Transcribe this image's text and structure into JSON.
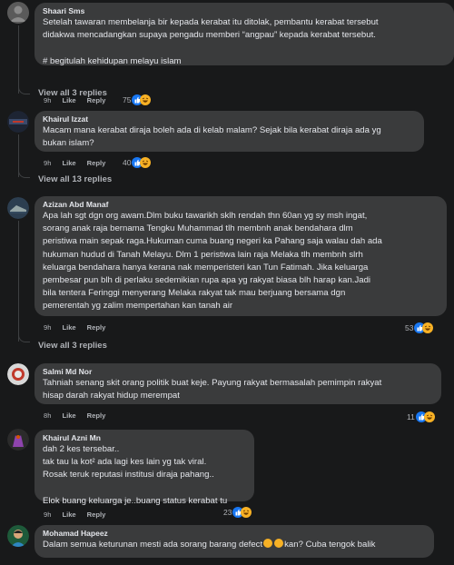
{
  "comments": [
    {
      "name": "Shaari Sms",
      "text": "Setelah tawaran membelanja bir kepada kerabat itu ditolak, pembantu kerabat tersebut\ndidakwa mencadangkan supaya pengadu memberi “angpau” kepada kerabat tersebut.\n\n# begitulah kehidupan melayu islam",
      "time": "9h",
      "like": "Like",
      "reply": "Reply",
      "reactions": "75",
      "view_replies": "View all 3 replies"
    },
    {
      "name": "Khairul Izzat",
      "text": "Macam mana kerabat diraja boleh ada di kelab malam? Sejak bila kerabat diraja ada yg\nbukan islam?",
      "time": "9h",
      "like": "Like",
      "reply": "Reply",
      "reactions": "40",
      "view_replies": "View all 13 replies"
    },
    {
      "name": "Azizan Abd Manaf",
      "text": "Apa lah sgt dgn org awam.Dlm buku tawarikh sklh rendah thn 60an yg sy msh ingat,\nsorang anak raja bernama Tengku Muhammad tlh membnh anak bendahara dlm\nperistiwa main sepak raga.Hukuman cuma buang negeri ka Pahang saja walau dah ada\nhukuman hudud di Tanah Melayu. Dlm 1 peristiwa lain raja Melaka tlh membnh slrh\nkeluarga bendahara hanya kerana nak memperisteri kan Tun Fatimah. Jika keluarga\npembesar pun blh di perlaku sedemikian rupa apa yg rakyat biasa blh harap kan.Jadi\nbila tentera Feringgi menyerang Melaka rakyat tak mau berjuang bersama dgn\npemerentah yg zalim mempertahan kan tanah air",
      "time": "9h",
      "like": "Like",
      "reply": "Reply",
      "reactions": "53",
      "view_replies": "View all 3 replies"
    },
    {
      "name": "Salmi Md Nor",
      "text": "Tahniah senang skit orang politik buat keje. Payung rakyat bermasalah pemimpin rakyat\nhisap darah rakyat hidup merempat",
      "time": "8h",
      "like": "Like",
      "reply": "Reply",
      "reactions": "11"
    },
    {
      "name": "Khairul Azni Mn",
      "text": "dah 2 kes tersebar..\ntak tau la kot² ada lagi kes lain yg tak viral.\nRosak teruk reputasi institusi diraja pahang..\n\nElok buang keluarga je..buang status kerabat tu",
      "time": "9h",
      "like": "Like",
      "reply": "Reply",
      "reactions": "23"
    },
    {
      "name": "Mohamad Hapeez",
      "text_a": "Dalam semua keturunan mesti ada sorang barang defect",
      "text_b": "kan? Cuba tengok balik"
    }
  ],
  "colors": {
    "background": "#18191a",
    "bubble": "#3a3b3c",
    "text": "#e4e6eb",
    "secondary": "#b0b3b8",
    "like_blue": "#1877f2",
    "haha_yellow": "#f7b125"
  },
  "icons": [
    "like-reaction-icon",
    "haha-reaction-icon",
    "avatar"
  ]
}
